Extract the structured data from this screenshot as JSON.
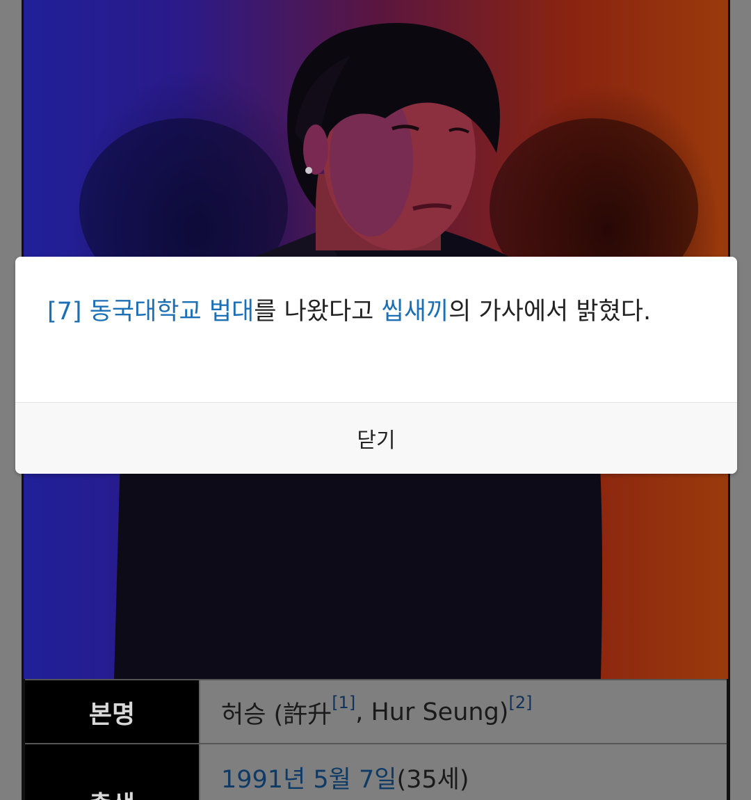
{
  "footnote": {
    "ref": "[7]",
    "link_school": "동국대학교 법대",
    "text_1": "를 나왔다고 ",
    "link_song": "씹새끼",
    "text_2": "의 가사에서 밝혔다.",
    "link_color": "#1a6fb5"
  },
  "dialog": {
    "close_label": "닫기"
  },
  "infobox": {
    "rows": [
      {
        "label": "본명",
        "value_main": "허승 (許升",
        "sup_1": "[1]",
        "value_mid": ", Hur Seung)",
        "sup_2": "[2]"
      },
      {
        "label": "출생",
        "date_link": "1991년 5월 7일",
        "age": " (35세)"
      }
    ]
  },
  "photo": {
    "background_left": "#202098",
    "background_right": "#9a3a0c"
  }
}
